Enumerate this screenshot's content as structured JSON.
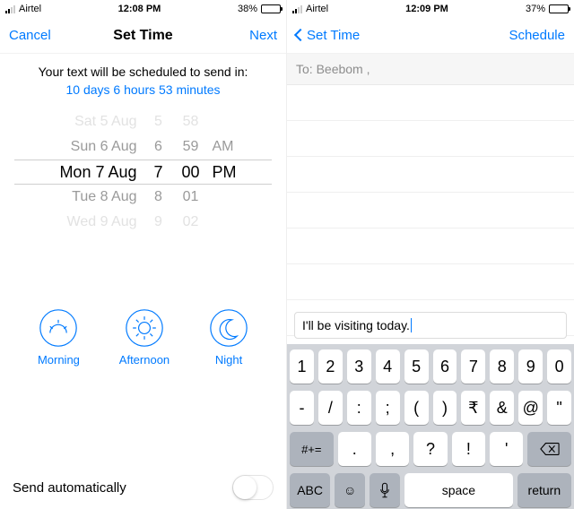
{
  "left": {
    "status": {
      "carrier": "Airtel",
      "time": "12:08 PM",
      "battery_pct": "38%"
    },
    "nav": {
      "cancel": "Cancel",
      "title": "Set Time",
      "next": "Next"
    },
    "info_line": "Your text will be scheduled to send in:",
    "countdown": "10 days 6 hours 53 minutes",
    "picker": {
      "dates": [
        "Sat 5 Aug",
        "Sun 6 Aug",
        "Mon 7 Aug",
        "Tue 8 Aug",
        "Wed 9 Aug"
      ],
      "hours": [
        "5",
        "6",
        "7",
        "8",
        "9"
      ],
      "minutes": [
        "58",
        "59",
        "00",
        "01",
        "02"
      ],
      "period": [
        "AM",
        "PM"
      ]
    },
    "presets": {
      "morning": "Morning",
      "afternoon": "Afternoon",
      "night": "Night"
    },
    "auto_label": "Send automatically"
  },
  "right": {
    "status": {
      "carrier": "Airtel",
      "time": "12:09 PM",
      "battery_pct": "37%"
    },
    "nav": {
      "back": "Set Time",
      "schedule": "Schedule"
    },
    "to_prefix": "To: ",
    "to_value": "Beebom ,",
    "compose_text": "I'll be visiting today.",
    "keyboard": {
      "row1": [
        "1",
        "2",
        "3",
        "4",
        "5",
        "6",
        "7",
        "8",
        "9",
        "0"
      ],
      "row2": [
        "-",
        "/",
        ":",
        ";",
        "(",
        ")",
        "₹",
        "&",
        "@",
        "\""
      ],
      "row3_sym": "#+=",
      "row3": [
        ".",
        ",",
        "?",
        "!",
        "'"
      ],
      "abc": "ABC",
      "space": "space",
      "ret": "return"
    }
  }
}
